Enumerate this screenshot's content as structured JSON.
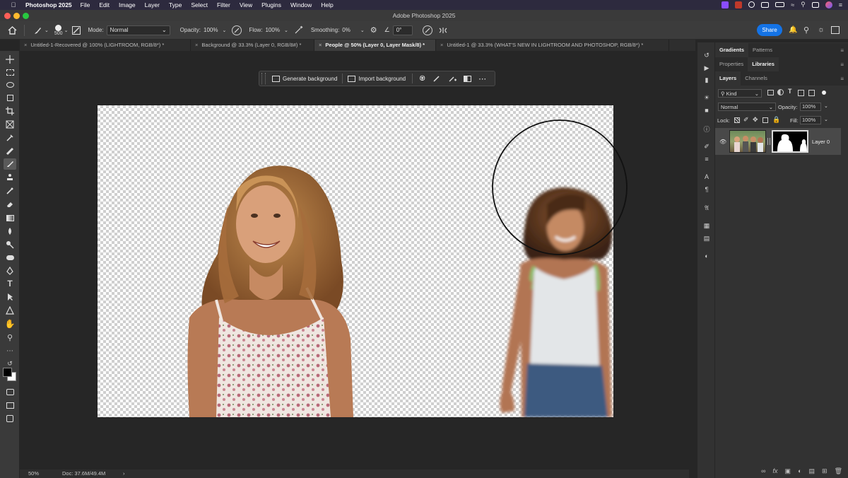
{
  "menubar": {
    "app_name": "Photoshop 2025",
    "items": [
      "File",
      "Edit",
      "Image",
      "Layer",
      "Type",
      "Select",
      "Filter",
      "View",
      "Plugins",
      "Window",
      "Help"
    ]
  },
  "titlebar": {
    "title": "Adobe Photoshop 2025"
  },
  "options": {
    "brush_size": "500",
    "mode_label": "Mode:",
    "mode_value": "Normal",
    "opacity_label": "Opacity:",
    "opacity_value": "100%",
    "flow_label": "Flow:",
    "flow_value": "100%",
    "smoothing_label": "Smoothing:",
    "smoothing_value": "0%",
    "angle_value": "0°",
    "share_label": "Share"
  },
  "tabs": [
    {
      "label": "Untitled-1-Recovered @ 100% (LIGHTROOM, RGB/8*) *"
    },
    {
      "label": "Background @ 33.3% (Layer 0, RGB/8#) *"
    },
    {
      "label": "People @ 50% (Layer 0, Layer Mask/8) *"
    },
    {
      "label": "Untitled-1 @ 33.3% (WHAT'S NEW IN LIGHTROOM AND PHOTOSHOP, RGB/8*) *"
    }
  ],
  "taskbar": {
    "generate_label": "Generate background",
    "import_label": "Import background"
  },
  "statusbar": {
    "zoom": "50%",
    "doc": "Doc: 37.6M/49.4M"
  },
  "panels": {
    "group1": [
      "Gradients",
      "Patterns"
    ],
    "group2": [
      "Properties",
      "Libraries"
    ],
    "group3": [
      "Layers",
      "Channels"
    ],
    "filter_kind": "Kind",
    "blend_mode": "Normal",
    "opacity_label": "Opacity:",
    "opacity_value": "100%",
    "lock_label": "Lock:",
    "fill_label": "Fill:",
    "fill_value": "100%",
    "layer_name": "Layer 0"
  },
  "colors": {
    "accent": "#1473e6",
    "menubar": "#2d2a3e"
  }
}
